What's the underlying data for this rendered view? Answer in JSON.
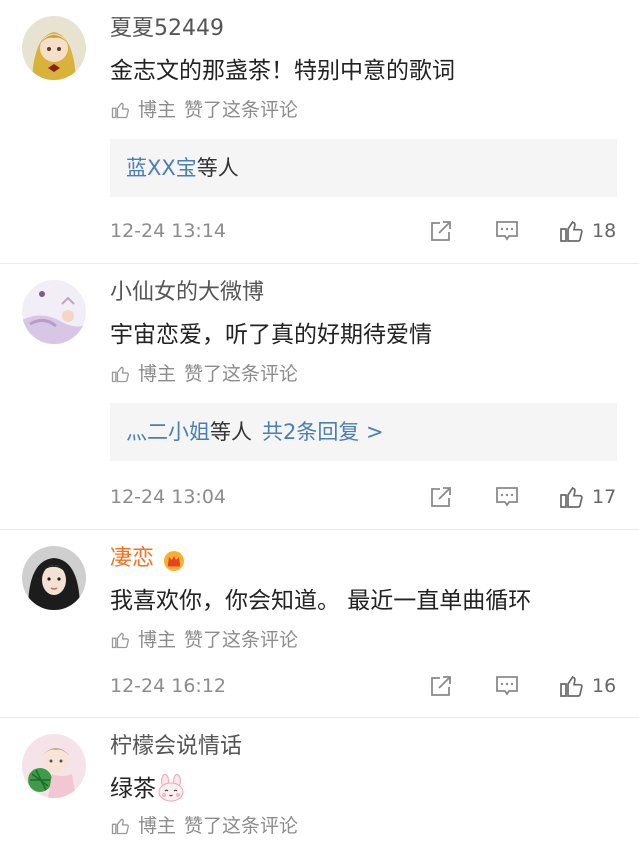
{
  "comments": [
    {
      "username": "夏夏52449",
      "text": "金志文的那盏茶！特别中意的歌词",
      "liked_by_label": "博主",
      "liked_text": "赞了这条评论",
      "reply_names": "蓝XX宝",
      "reply_suffix": "等人",
      "time": "12-24 13:14",
      "likes": "18"
    },
    {
      "username": "小仙女的大微博",
      "text": "宇宙恋爱，听了真的好期待爱情",
      "liked_by_label": "博主",
      "liked_text": "赞了这条评论",
      "reply_names": "灬二小姐",
      "reply_suffix": "等人",
      "reply_total": "共2条回复 >",
      "time": "12-24 13:04",
      "likes": "17"
    },
    {
      "username": "凄恋",
      "text": "我喜欢你，你会知道。 最近一直单曲循环",
      "liked_by_label": "博主",
      "liked_text": "赞了这条评论",
      "time": "12-24 16:12",
      "likes": "16"
    },
    {
      "username": "柠檬会说情话",
      "text": "绿茶",
      "liked_by_label": "博主",
      "liked_text": "赞了这条评论"
    }
  ],
  "colors": {
    "link": "#4a7fb5",
    "vip_name": "#f4711f",
    "meta": "#8c8c8c",
    "reply_bg": "#f5f5f5"
  },
  "icons": [
    "avatar-image",
    "thumb-up-icon",
    "share-icon",
    "reply-icon",
    "like-icon",
    "vip-crown-icon",
    "bunny-emoji-icon"
  ]
}
